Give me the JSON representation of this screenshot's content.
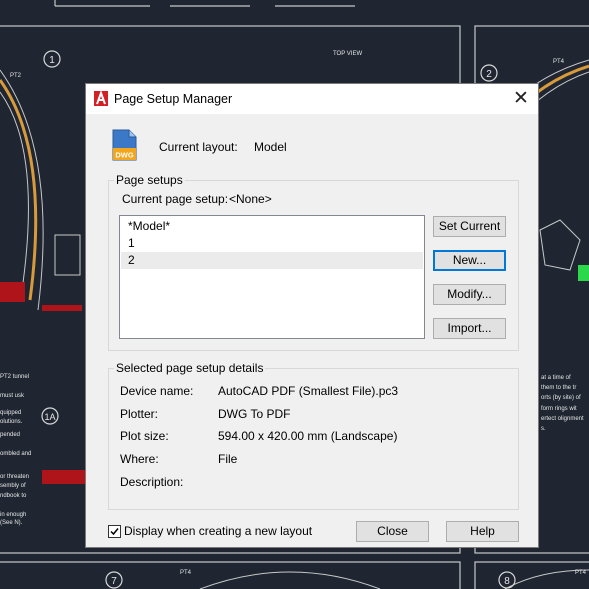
{
  "dialog": {
    "title": "Page Setup Manager",
    "current_layout_label": "Current layout:",
    "current_layout_value": "Model",
    "icon_badge": "DWG",
    "page_setups_group": "Page setups",
    "current_page_setup_label": "Current page setup:",
    "current_page_setup_value": "<None>",
    "list_items": [
      "*Model*",
      "1",
      "2"
    ],
    "selected_index": 2,
    "buttons": {
      "set_current": "Set Current",
      "new": "New...",
      "modify": "Modify...",
      "import": "Import...",
      "close": "Close",
      "help": "Help"
    },
    "details_group": "Selected page setup details",
    "details": [
      {
        "label": "Device name:",
        "value": "AutoCAD PDF (Smallest File).pc3"
      },
      {
        "label": "Plotter:",
        "value": "DWG To PDF"
      },
      {
        "label": "Plot size:",
        "value": "594.00 x 420.00 mm (Landscape)"
      },
      {
        "label": "Where:",
        "value": "File"
      },
      {
        "label": "Description:",
        "value": ""
      }
    ],
    "checkbox_label": "Display when creating a new layout",
    "checkbox_checked": true
  },
  "background": {
    "top_view_label": "TOP VIEW",
    "markers": [
      "1",
      "2",
      "1A",
      "7",
      "8"
    ],
    "point_labels": [
      "PT2",
      "PT4",
      "PT4",
      "PT4"
    ],
    "notes_left": [
      "PT2 tunnel",
      "must usk",
      "quipped",
      "olutions.",
      "pended",
      "ombled and",
      "or threaten",
      "sembly of",
      "ndbook to",
      "in enough",
      "(See N)."
    ],
    "notes_right": [
      "at a time of",
      "them to the tr",
      "orts (by site) of",
      "form rings wit",
      "ertect olignment",
      "s."
    ]
  },
  "colors": {
    "background": "#1f2631",
    "cad_lines": "#c8c8c8",
    "hatch_red": "#b0141b",
    "accent_green": "#2bd84a",
    "dialog_bg": "#f0f0f0",
    "focus_blue": "#0078d7",
    "autocad_red": "#d32027"
  }
}
